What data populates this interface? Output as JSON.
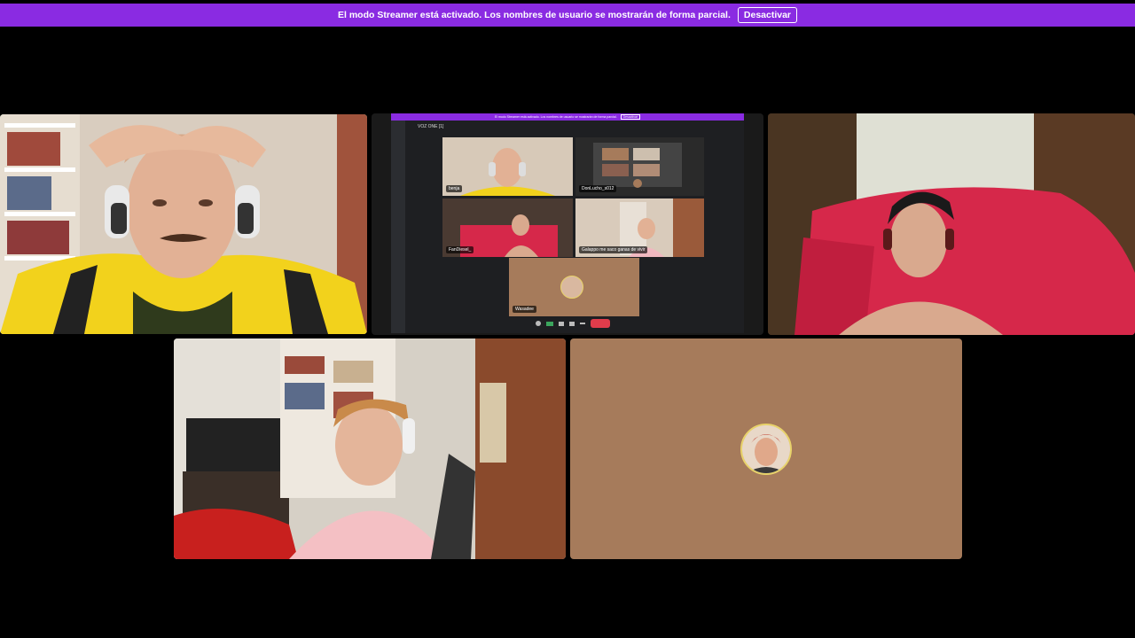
{
  "streamer_banner": {
    "message": "El modo Streamer está activado. Los nombres de usuario se mostrarán de forma parcial.",
    "button_label": "Desactivar",
    "color": "#8a2be2"
  },
  "screen_share": {
    "banner_message": "El modo Streamer está activado. Los nombres de usuario se mostrarán de forma parcial.",
    "banner_button": "Desactivar",
    "channel_title": "VOZ ONE [1]",
    "tiles": [
      {
        "label": "benja"
      },
      {
        "label": "DonLucho_s012"
      },
      {
        "label": "FanDiesel_"
      },
      {
        "label": "Galappo me saco ganas de vivir"
      },
      {
        "label": "Wasadee"
      }
    ]
  },
  "participants": [
    {
      "name": "speaker-tile",
      "speaking": true
    },
    {
      "name": "screen-share-tile"
    },
    {
      "name": "couch-participant-tile"
    },
    {
      "name": "pink-shirt-participant-tile"
    },
    {
      "name": "avatar-only-tile",
      "background": "#a67b5b"
    }
  ],
  "colors": {
    "speaking": "#3ba55d",
    "accent": "#8a2be2",
    "avatar_tile_bg": "#a67b5b",
    "hangup": "#e03c4b"
  }
}
